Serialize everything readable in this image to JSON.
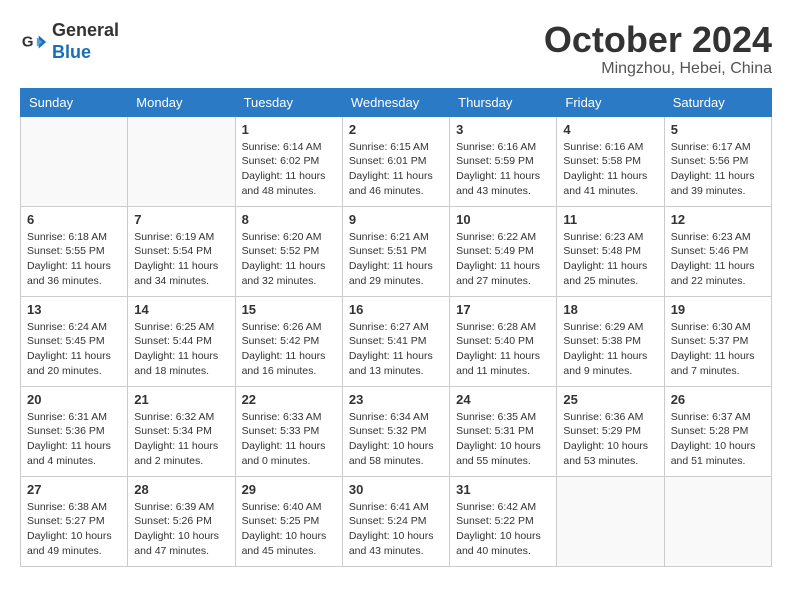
{
  "header": {
    "logo_general": "General",
    "logo_blue": "Blue",
    "month": "October 2024",
    "location": "Mingzhou, Hebei, China"
  },
  "weekdays": [
    "Sunday",
    "Monday",
    "Tuesday",
    "Wednesday",
    "Thursday",
    "Friday",
    "Saturday"
  ],
  "weeks": [
    [
      {
        "day": "",
        "info": ""
      },
      {
        "day": "",
        "info": ""
      },
      {
        "day": "1",
        "info": "Sunrise: 6:14 AM\nSunset: 6:02 PM\nDaylight: 11 hours and 48 minutes."
      },
      {
        "day": "2",
        "info": "Sunrise: 6:15 AM\nSunset: 6:01 PM\nDaylight: 11 hours and 46 minutes."
      },
      {
        "day": "3",
        "info": "Sunrise: 6:16 AM\nSunset: 5:59 PM\nDaylight: 11 hours and 43 minutes."
      },
      {
        "day": "4",
        "info": "Sunrise: 6:16 AM\nSunset: 5:58 PM\nDaylight: 11 hours and 41 minutes."
      },
      {
        "day": "5",
        "info": "Sunrise: 6:17 AM\nSunset: 5:56 PM\nDaylight: 11 hours and 39 minutes."
      }
    ],
    [
      {
        "day": "6",
        "info": "Sunrise: 6:18 AM\nSunset: 5:55 PM\nDaylight: 11 hours and 36 minutes."
      },
      {
        "day": "7",
        "info": "Sunrise: 6:19 AM\nSunset: 5:54 PM\nDaylight: 11 hours and 34 minutes."
      },
      {
        "day": "8",
        "info": "Sunrise: 6:20 AM\nSunset: 5:52 PM\nDaylight: 11 hours and 32 minutes."
      },
      {
        "day": "9",
        "info": "Sunrise: 6:21 AM\nSunset: 5:51 PM\nDaylight: 11 hours and 29 minutes."
      },
      {
        "day": "10",
        "info": "Sunrise: 6:22 AM\nSunset: 5:49 PM\nDaylight: 11 hours and 27 minutes."
      },
      {
        "day": "11",
        "info": "Sunrise: 6:23 AM\nSunset: 5:48 PM\nDaylight: 11 hours and 25 minutes."
      },
      {
        "day": "12",
        "info": "Sunrise: 6:23 AM\nSunset: 5:46 PM\nDaylight: 11 hours and 22 minutes."
      }
    ],
    [
      {
        "day": "13",
        "info": "Sunrise: 6:24 AM\nSunset: 5:45 PM\nDaylight: 11 hours and 20 minutes."
      },
      {
        "day": "14",
        "info": "Sunrise: 6:25 AM\nSunset: 5:44 PM\nDaylight: 11 hours and 18 minutes."
      },
      {
        "day": "15",
        "info": "Sunrise: 6:26 AM\nSunset: 5:42 PM\nDaylight: 11 hours and 16 minutes."
      },
      {
        "day": "16",
        "info": "Sunrise: 6:27 AM\nSunset: 5:41 PM\nDaylight: 11 hours and 13 minutes."
      },
      {
        "day": "17",
        "info": "Sunrise: 6:28 AM\nSunset: 5:40 PM\nDaylight: 11 hours and 11 minutes."
      },
      {
        "day": "18",
        "info": "Sunrise: 6:29 AM\nSunset: 5:38 PM\nDaylight: 11 hours and 9 minutes."
      },
      {
        "day": "19",
        "info": "Sunrise: 6:30 AM\nSunset: 5:37 PM\nDaylight: 11 hours and 7 minutes."
      }
    ],
    [
      {
        "day": "20",
        "info": "Sunrise: 6:31 AM\nSunset: 5:36 PM\nDaylight: 11 hours and 4 minutes."
      },
      {
        "day": "21",
        "info": "Sunrise: 6:32 AM\nSunset: 5:34 PM\nDaylight: 11 hours and 2 minutes."
      },
      {
        "day": "22",
        "info": "Sunrise: 6:33 AM\nSunset: 5:33 PM\nDaylight: 11 hours and 0 minutes."
      },
      {
        "day": "23",
        "info": "Sunrise: 6:34 AM\nSunset: 5:32 PM\nDaylight: 10 hours and 58 minutes."
      },
      {
        "day": "24",
        "info": "Sunrise: 6:35 AM\nSunset: 5:31 PM\nDaylight: 10 hours and 55 minutes."
      },
      {
        "day": "25",
        "info": "Sunrise: 6:36 AM\nSunset: 5:29 PM\nDaylight: 10 hours and 53 minutes."
      },
      {
        "day": "26",
        "info": "Sunrise: 6:37 AM\nSunset: 5:28 PM\nDaylight: 10 hours and 51 minutes."
      }
    ],
    [
      {
        "day": "27",
        "info": "Sunrise: 6:38 AM\nSunset: 5:27 PM\nDaylight: 10 hours and 49 minutes."
      },
      {
        "day": "28",
        "info": "Sunrise: 6:39 AM\nSunset: 5:26 PM\nDaylight: 10 hours and 47 minutes."
      },
      {
        "day": "29",
        "info": "Sunrise: 6:40 AM\nSunset: 5:25 PM\nDaylight: 10 hours and 45 minutes."
      },
      {
        "day": "30",
        "info": "Sunrise: 6:41 AM\nSunset: 5:24 PM\nDaylight: 10 hours and 43 minutes."
      },
      {
        "day": "31",
        "info": "Sunrise: 6:42 AM\nSunset: 5:22 PM\nDaylight: 10 hours and 40 minutes."
      },
      {
        "day": "",
        "info": ""
      },
      {
        "day": "",
        "info": ""
      }
    ]
  ]
}
